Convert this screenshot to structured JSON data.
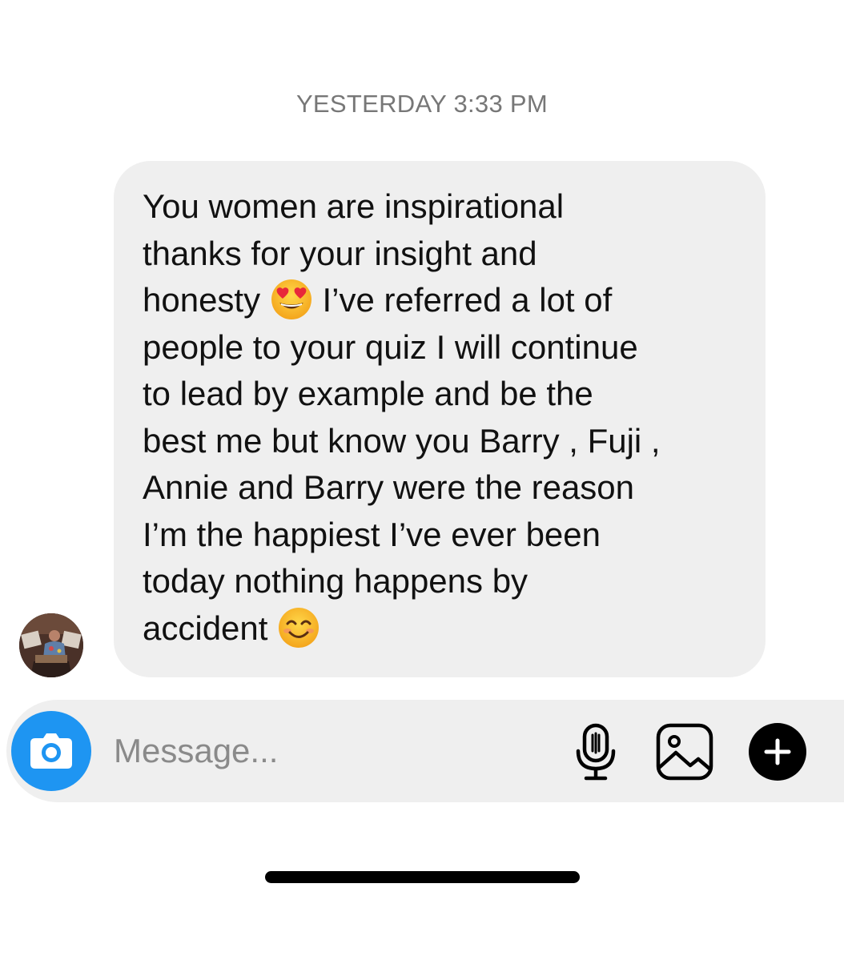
{
  "thread": {
    "timestamp": "YESTERDAY 3:33 PM"
  },
  "message": {
    "lines": [
      {
        "text": "You women are inspirational"
      },
      {
        "text": "thanks for your insight and"
      },
      {
        "text": "honesty",
        "emoji": "heart-eyes-emoji",
        "after": " I’ve referred a lot of"
      },
      {
        "text": "people to your quiz I will continue"
      },
      {
        "text": "to lead by example and be the"
      },
      {
        "text": "best me but know you Barry , Fuji ,"
      },
      {
        "text": "Annie and Barry were the reason"
      },
      {
        "text": "I’m the happiest I’ve ever been"
      },
      {
        "text": "today nothing happens by"
      },
      {
        "text": "accident",
        "emoji": "smiling-face-emoji",
        "after": ""
      }
    ],
    "bubble_color": "#efefef"
  },
  "composer": {
    "placeholder": "Message...",
    "value": "",
    "accent_color": "#1e95f2",
    "icons": [
      "camera-icon",
      "microphone-icon",
      "photo-gallery-icon",
      "plus-icon"
    ]
  }
}
